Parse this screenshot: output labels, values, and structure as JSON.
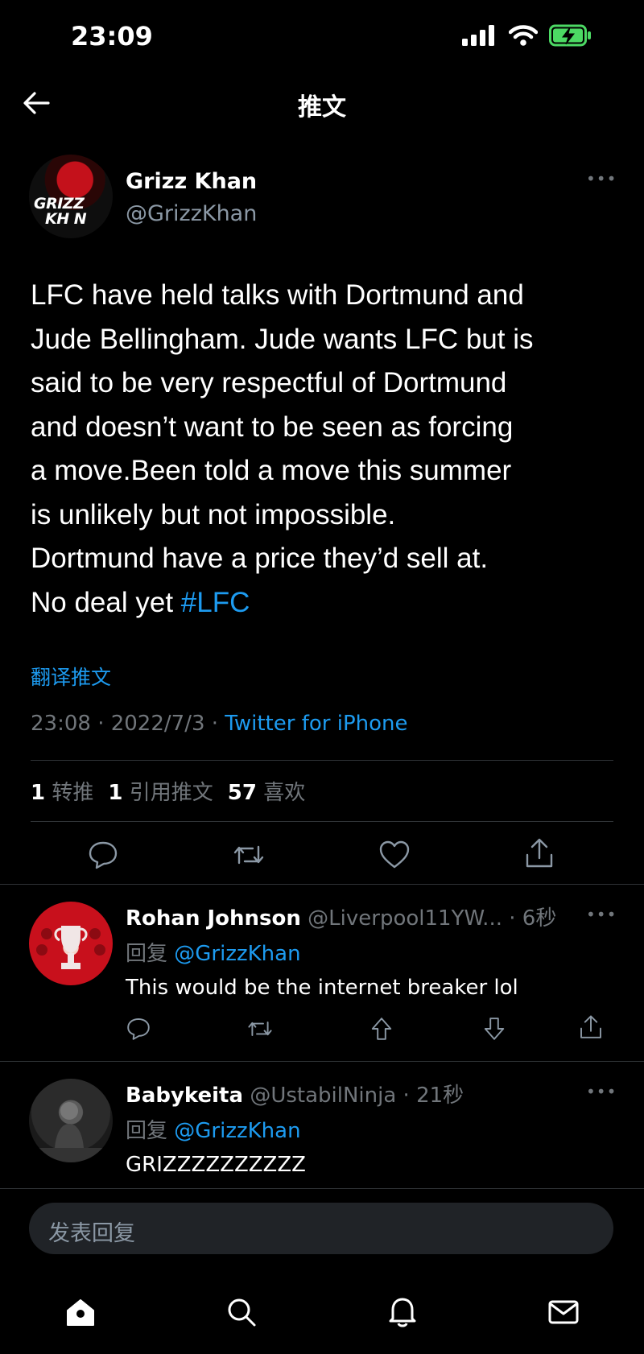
{
  "status_bar": {
    "time": "23:09"
  },
  "header": {
    "title": "推文"
  },
  "tweet": {
    "author_name": "Grizz Khan",
    "author_handle": "@GrizzKhan",
    "avatar_text_line1": "GRIZZ",
    "avatar_text_line2": "KH N",
    "text_line1": "LFC have held talks with Dortmund and",
    "text_line2": "Jude Bellingham. Jude wants LFC but is",
    "text_line3": "said to be very respectful of Dortmund",
    "text_line4": "and doesn’t want to be seen as forcing",
    "text_line5": "a move.Been told a move this summer",
    "text_line6": "is unlikely but not impossible.",
    "text_line7": "Dortmund have a price they’d sell at.",
    "text_line8_prefix": "No deal yet ",
    "hashtag": "#LFC",
    "translate_label": "翻译推文",
    "timestamp": "23:08 · 2022/7/3 · ",
    "source": "Twitter for iPhone"
  },
  "stats": {
    "retweets_count": "1",
    "retweets_label": "转推",
    "quotes_count": "1",
    "quotes_label": "引用推文",
    "likes_count": "57",
    "likes_label": "喜欢"
  },
  "replies": [
    {
      "name": "Rohan Johnson",
      "handle": "@Liverpool11YW...",
      "time": " · 6秒",
      "reply_prefix": "回复 ",
      "reply_to": "@GrizzKhan",
      "text": "This would be the internet breaker lol"
    },
    {
      "name": "Babykeita",
      "handle": "@UstabilNinja",
      "time": " · 21秒",
      "reply_prefix": "回复 ",
      "reply_to": "@GrizzKhan",
      "text": "GRIZZZZZZZZZZ"
    }
  ],
  "composer": {
    "placeholder": "发表回复"
  },
  "colors": {
    "accent": "#1d9bf0",
    "background": "#000000",
    "muted": "#71767b",
    "battery": "#4cd964"
  }
}
